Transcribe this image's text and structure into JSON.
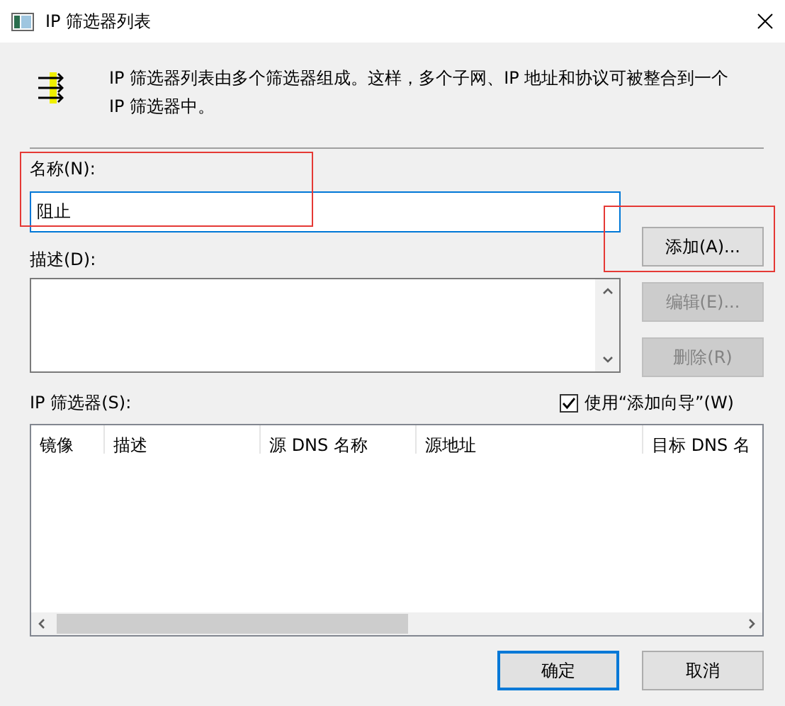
{
  "window": {
    "title": "IP 筛选器列表"
  },
  "intro": "IP 筛选器列表由多个筛选器组成。这样，多个子网、IP 地址和协议可被整合到一个 IP 筛选器中。",
  "name_field": {
    "label": "名称(N):",
    "value": "阻止",
    "focused": true
  },
  "description_field": {
    "label": "描述(D):"
  },
  "side_buttons": [
    {
      "label": "添加(A)...",
      "disabled": false
    },
    {
      "label": "编辑(E)...",
      "disabled": true
    },
    {
      "label": "删除(R)",
      "disabled": true
    }
  ],
  "filters": {
    "label": "IP 筛选器(S):",
    "wizard": {
      "label": "使用“添加向导”(W)",
      "checked": true
    },
    "columns": [
      "镜像",
      "描述",
      "源 DNS 名称",
      "源地址",
      "目标 DNS 名"
    ]
  },
  "dialog_buttons": [
    {
      "label": "确定",
      "default": true
    },
    {
      "label": "取消",
      "default": false
    }
  ]
}
